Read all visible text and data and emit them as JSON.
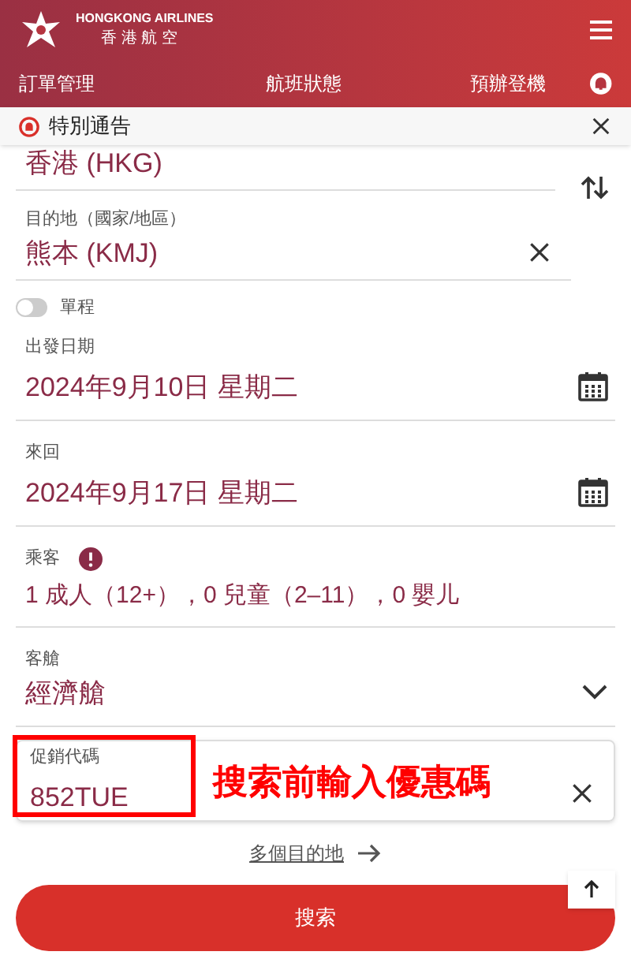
{
  "header": {
    "brand_en": "HONGKONG AIRLINES",
    "brand_zh": "香 港 航 空",
    "nav": [
      "訂單管理",
      "航班狀態",
      "預辦登機"
    ]
  },
  "notice": {
    "title": "特別通告"
  },
  "origin": {
    "value": "香港 (HKG)"
  },
  "destination": {
    "label": "目的地（國家/地區）",
    "value": "熊本 (KMJ)"
  },
  "one_way": {
    "label": "單程",
    "on": false
  },
  "depart": {
    "label": "出發日期",
    "value": "2024年9月10日 星期二"
  },
  "return": {
    "label": "來回",
    "value": "2024年9月17日 星期二"
  },
  "passengers": {
    "label": "乘客",
    "value": "1 成人（12+），0 兒童（2–11），0 嬰儿"
  },
  "cabin": {
    "label": "客艙",
    "value": "經濟艙"
  },
  "promo": {
    "label": "促銷代碼",
    "value": "852TUE",
    "annotation": "搜索前輸入優惠碼"
  },
  "multi_city": "多個目的地",
  "search_button": "搜索"
}
